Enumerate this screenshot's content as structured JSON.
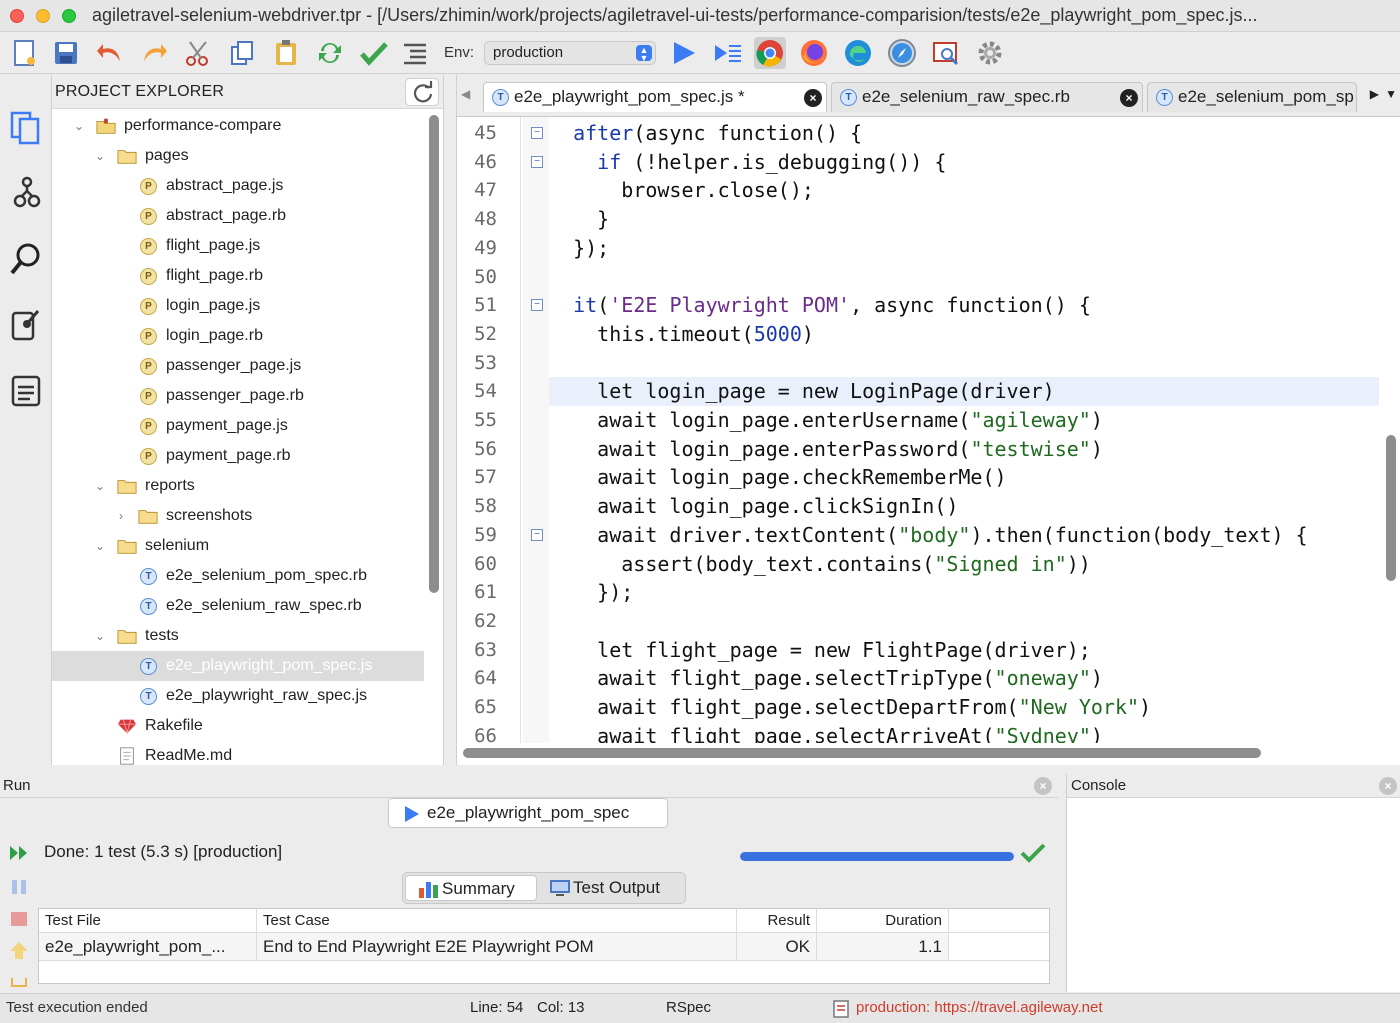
{
  "window": {
    "title": "agiletravel-selenium-webdriver.tpr - [/Users/zhimin/work/projects/agiletravel-ui-tests/performance-comparision/tests/e2e_playwright_pom_spec.js..."
  },
  "toolbar": {
    "env_label": "Env:",
    "env_value": "production"
  },
  "explorer": {
    "title": "PROJECT EXPLORER",
    "tree": [
      {
        "label": "performance-compare",
        "type": "project",
        "depth": 0,
        "expanded": true
      },
      {
        "label": "pages",
        "type": "folder",
        "depth": 1,
        "expanded": true
      },
      {
        "label": "abstract_page.js",
        "type": "page",
        "depth": 2
      },
      {
        "label": "abstract_page.rb",
        "type": "page",
        "depth": 2
      },
      {
        "label": "flight_page.js",
        "type": "page",
        "depth": 2
      },
      {
        "label": "flight_page.rb",
        "type": "page",
        "depth": 2
      },
      {
        "label": "login_page.js",
        "type": "page",
        "depth": 2
      },
      {
        "label": "login_page.rb",
        "type": "page",
        "depth": 2
      },
      {
        "label": "passenger_page.js",
        "type": "page",
        "depth": 2
      },
      {
        "label": "passenger_page.rb",
        "type": "page",
        "depth": 2
      },
      {
        "label": "payment_page.js",
        "type": "page",
        "depth": 2
      },
      {
        "label": "payment_page.rb",
        "type": "page",
        "depth": 2
      },
      {
        "label": "reports",
        "type": "folder",
        "depth": 1,
        "expanded": true
      },
      {
        "label": "screenshots",
        "type": "folder",
        "depth": 2,
        "expanded": false
      },
      {
        "label": "selenium",
        "type": "folder",
        "depth": 1,
        "expanded": true
      },
      {
        "label": "e2e_selenium_pom_spec.rb",
        "type": "test",
        "depth": 2
      },
      {
        "label": "e2e_selenium_raw_spec.rb",
        "type": "test",
        "depth": 2
      },
      {
        "label": "tests",
        "type": "folder",
        "depth": 1,
        "expanded": true
      },
      {
        "label": "e2e_playwright_pom_spec.js",
        "type": "test",
        "depth": 2,
        "selected": true
      },
      {
        "label": "e2e_playwright_raw_spec.js",
        "type": "test",
        "depth": 2
      },
      {
        "label": "Rakefile",
        "type": "rake",
        "depth": 1
      },
      {
        "label": "ReadMe.md",
        "type": "doc",
        "depth": 1
      }
    ]
  },
  "editor": {
    "tabs": [
      {
        "label": "e2e_playwright_pom_spec.js *",
        "active": true
      },
      {
        "label": "e2e_selenium_raw_spec.rb",
        "active": false
      },
      {
        "label": "e2e_selenium_pom_sp",
        "active": false
      }
    ],
    "lines": [
      {
        "n": "45",
        "fold": true,
        "parts": [
          [
            "",
            "  "
          ],
          [
            "kw",
            "after"
          ],
          [
            "",
            "(async function() {"
          ]
        ]
      },
      {
        "n": "46",
        "fold": true,
        "parts": [
          [
            "",
            "    "
          ],
          [
            "kw",
            "if"
          ],
          [
            "",
            " (!helper.is_debugging()) {"
          ]
        ]
      },
      {
        "n": "47",
        "parts": [
          [
            "",
            "      browser.close();"
          ]
        ]
      },
      {
        "n": "48",
        "parts": [
          [
            "",
            "    }"
          ]
        ]
      },
      {
        "n": "49",
        "parts": [
          [
            "",
            "  });"
          ]
        ]
      },
      {
        "n": "50",
        "parts": [
          [
            "",
            ""
          ]
        ]
      },
      {
        "n": "51",
        "fold": true,
        "parts": [
          [
            "",
            "  "
          ],
          [
            "kw",
            "it"
          ],
          [
            "",
            "("
          ],
          [
            "tstr",
            "'E2E Playwright POM'"
          ],
          [
            "",
            ", async function() {"
          ]
        ]
      },
      {
        "n": "52",
        "parts": [
          [
            "",
            "    this.timeout("
          ],
          [
            "num",
            "5000"
          ],
          [
            "",
            ")"
          ]
        ]
      },
      {
        "n": "53",
        "parts": [
          [
            "",
            ""
          ]
        ]
      },
      {
        "n": "54",
        "current": true,
        "parts": [
          [
            "",
            "    let login_page = new LoginPage(driver)"
          ]
        ]
      },
      {
        "n": "55",
        "parts": [
          [
            "",
            "    await login_page.enterUsername("
          ],
          [
            "str",
            "\"agileway\""
          ],
          [
            "",
            ")"
          ]
        ]
      },
      {
        "n": "56",
        "parts": [
          [
            "",
            "    await login_page.enterPassword("
          ],
          [
            "str",
            "\"testwise\""
          ],
          [
            "",
            ")"
          ]
        ]
      },
      {
        "n": "57",
        "parts": [
          [
            "",
            "    await login_page.checkRememberMe()"
          ]
        ]
      },
      {
        "n": "58",
        "parts": [
          [
            "",
            "    await login_page.clickSignIn()"
          ]
        ]
      },
      {
        "n": "59",
        "fold": true,
        "parts": [
          [
            "",
            "    await driver.textContent("
          ],
          [
            "str",
            "\"body\""
          ],
          [
            "",
            ").then(function(body_text) {"
          ]
        ]
      },
      {
        "n": "60",
        "parts": [
          [
            "",
            "      assert(body_text.contains("
          ],
          [
            "str",
            "\"Signed in\""
          ],
          [
            "",
            "))"
          ]
        ]
      },
      {
        "n": "61",
        "parts": [
          [
            "",
            "    });"
          ]
        ]
      },
      {
        "n": "62",
        "parts": [
          [
            "",
            ""
          ]
        ]
      },
      {
        "n": "63",
        "parts": [
          [
            "",
            "    let flight_page = new FlightPage(driver);"
          ]
        ]
      },
      {
        "n": "64",
        "parts": [
          [
            "",
            "    await flight_page.selectTripType("
          ],
          [
            "str",
            "\"oneway\""
          ],
          [
            "",
            ")"
          ]
        ]
      },
      {
        "n": "65",
        "parts": [
          [
            "",
            "    await flight_page.selectDepartFrom("
          ],
          [
            "str",
            "\"New York\""
          ],
          [
            "",
            ")"
          ]
        ]
      },
      {
        "n": "66",
        "parts": [
          [
            "",
            "    await flight_page.selectArriveAt("
          ],
          [
            "str",
            "\"Sydney\""
          ],
          [
            "",
            ")"
          ]
        ]
      }
    ]
  },
  "run": {
    "title": "Run",
    "tab_label": "e2e_playwright_pom_spec",
    "done_text": "Done: 1 test (5.3 s) [production]",
    "progress": 1.0,
    "subtabs": [
      "Summary",
      "Test Output"
    ],
    "columns": [
      "Test File",
      "Test Case",
      "Result",
      "Duration"
    ],
    "rows": [
      {
        "file": "e2e_playwright_pom_...",
        "case": "End to End Playwright E2E Playwright POM",
        "result": "OK",
        "duration": "1.1"
      }
    ]
  },
  "console": {
    "title": "Console"
  },
  "status": {
    "message": "Test execution ended",
    "line": "Line: 54",
    "col": "Col: 13",
    "framework": "RSpec",
    "env": "production: https://travel.agileway.net"
  },
  "colors": {
    "keyword": "#1a3aa8",
    "string": "#1f6a1f",
    "test_title": "#6a2b8c",
    "env_status": "#d23b2b",
    "progress": "#3772e0"
  }
}
